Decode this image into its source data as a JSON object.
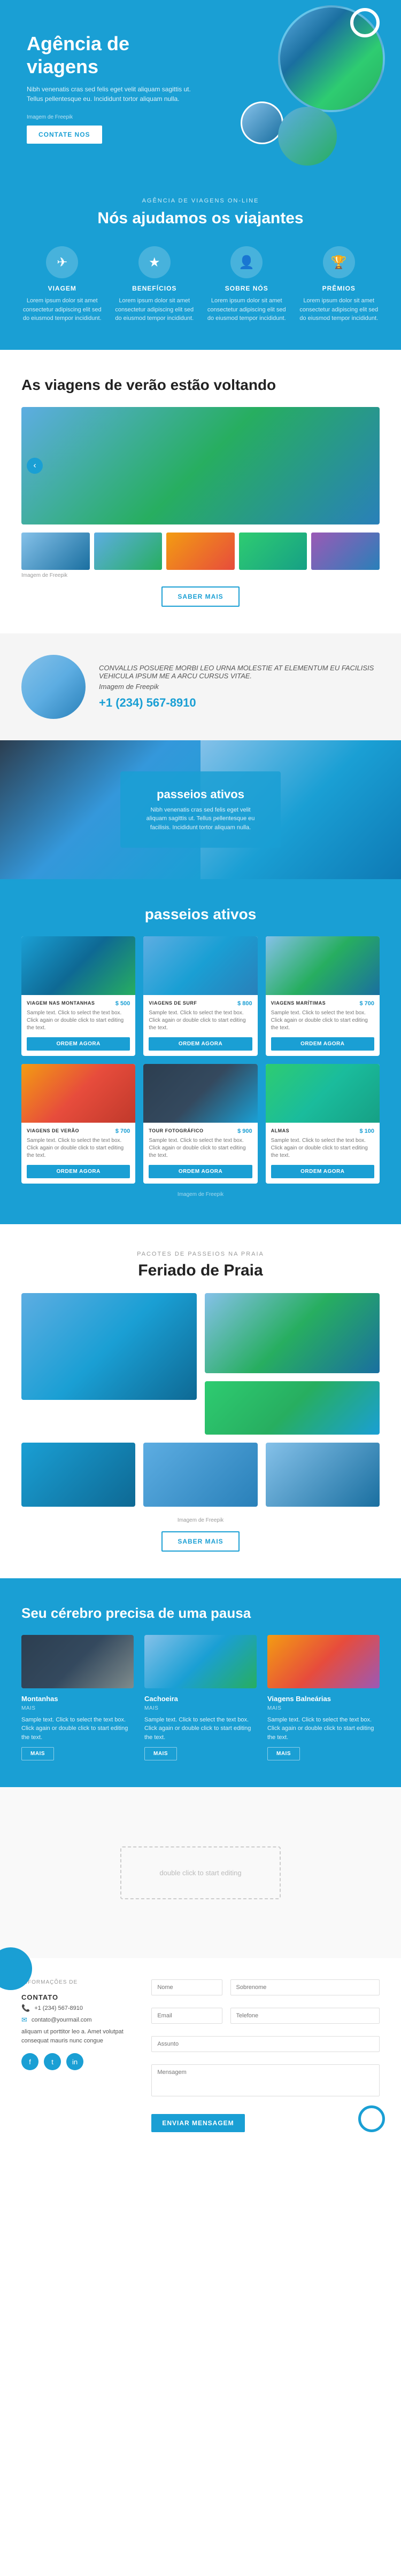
{
  "hero": {
    "title": "Agência de viagens",
    "text": "Nibh venenatis cras sed felis eget velit aliquam sagittis ut. Tellus pellentesque eu. Incididunt tortor aliquam nulla.",
    "img_label": "Imagem de Freepik",
    "btn_label": "CONTATE NOS"
  },
  "section_help": {
    "sub_title": "AGÊNCIA DE VIAGENS ON-LINE",
    "title": "Nós ajudamos os viajantes",
    "features": [
      {
        "icon": "✈",
        "title": "VIAGEM",
        "text": "Lorem ipsum dolor sit amet consectetur adipiscing elit sed do eiusmod tempor incididunt."
      },
      {
        "icon": "★",
        "title": "BENEFÍCIOS",
        "text": "Lorem ipsum dolor sit amet consectetur adipiscing elit sed do eiusmod tempor incididunt."
      },
      {
        "icon": "👤",
        "title": "SOBRE NÓS",
        "text": "Lorem ipsum dolor sit amet consectetur adipiscing elit sed do eiusmod tempor incididunt."
      },
      {
        "icon": "🏆",
        "title": "PRÊMIOS",
        "text": "Lorem ipsum dolor sit amet consectetur adipiscing elit sed do eiusmod tempor incididunt."
      }
    ]
  },
  "section_summer": {
    "title": "As viagens de verão estão voltando",
    "img_label": "Imagem de Freepik",
    "btn_label": "SABER MAIS"
  },
  "section_contact_banner": {
    "text": "CONVALLIS POSUERE MORBI LEO URNA MOLESTIE AT ELEMENTUM EU FACILISIS VEHICULA IPSUM ME A ARCU CURSUS VITAE.",
    "img_label": "Imagem de Freepik",
    "phone": "+1 (234) 567-8910"
  },
  "section_active_banner": {
    "title": "passeios ativos",
    "text": "Nibh venenatis cras sed felis eget velit aliquam sagittis ut. Tellus pellentesque eu facilisis. Incididunt tortor aliquam nulla."
  },
  "section_passeios": {
    "title": "passeios ativos",
    "img_label": "Imagem de Freepik",
    "cards": [
      {
        "name": "VIAGEM NAS MONTANHAS",
        "price": "$ 500",
        "text": "Sample text. Click to select the text box. Click again or double click to start editing the text.",
        "btn": "ORDEM AGORA"
      },
      {
        "name": "VIAGENS DE SURF",
        "price": "$ 800",
        "text": "Sample text. Click to select the text box. Click again or double click to start editing the text.",
        "btn": "ORDEM AGORA"
      },
      {
        "name": "VIAGENS MARÍTIMAS",
        "price": "$ 700",
        "text": "Sample text. Click to select the text box. Click again or double click to start editing the text.",
        "btn": "ORDEM AGORA"
      },
      {
        "name": "VIAGENS DE VERÃO",
        "price": "$ 700",
        "text": "Sample text. Click to select the text box. Click again or double click to start editing the text.",
        "btn": "ORDEM AGORA"
      },
      {
        "name": "TOUR FOTOGRÁFICO",
        "price": "$ 900",
        "text": "Sample text. Click to select the text box. Click again or double click to start editing the text.",
        "btn": "ORDEM AGORA"
      },
      {
        "name": "ALMAS",
        "price": "$ 100",
        "text": "Sample text. Click to select the text box. Click again or double click to start editing the text.",
        "btn": "ORDEM AGORA"
      }
    ]
  },
  "section_praia": {
    "sub_title": "PACOTES DE PASSEIOS NA PRAIA",
    "title": "Feriado de Praia",
    "img_label": "Imagem de Freepik",
    "btn_label": "SABER MAIS"
  },
  "section_cerebro": {
    "title": "Seu cérebro precisa de uma pausa",
    "cards": [
      {
        "title": "Montanhas",
        "sub": "MAIS",
        "text": "Sample text. Click to select the text box. Click again or double click to start editing the text.",
        "btn": "MAIS"
      },
      {
        "title": "Cachoeira",
        "sub": "MAIS",
        "text": "Sample text. Click to select the text box. Click again or double click to start editing the text.",
        "btn": "MAIS"
      },
      {
        "title": "Viagens Balneárias",
        "sub": "MAIS",
        "text": "Sample text. Click to select the text box. Click again or double click to start editing the text.",
        "btn": "MAIS"
      }
    ]
  },
  "footer": {
    "sub": "INFORMAÇÕES DE",
    "title": "contato",
    "phone": "+1 (234) 567-8910",
    "email": "contato@yourmail.com",
    "address": "aliquam ut porttitor leo a. Amet volutpat consequat mauris nunc congue",
    "social": [
      "f",
      "t",
      "in"
    ],
    "form": {
      "fields": [
        {
          "placeholder": "Nome"
        },
        {
          "placeholder": "Sobrenome"
        },
        {
          "placeholder": "Email"
        },
        {
          "placeholder": "Telefone"
        },
        {
          "placeholder": "Assunto"
        },
        {
          "placeholder": "Mensagem"
        }
      ],
      "btn_label": "ENVIAR MENSAGEM"
    }
  },
  "editing_placeholder": "double click to start editing"
}
